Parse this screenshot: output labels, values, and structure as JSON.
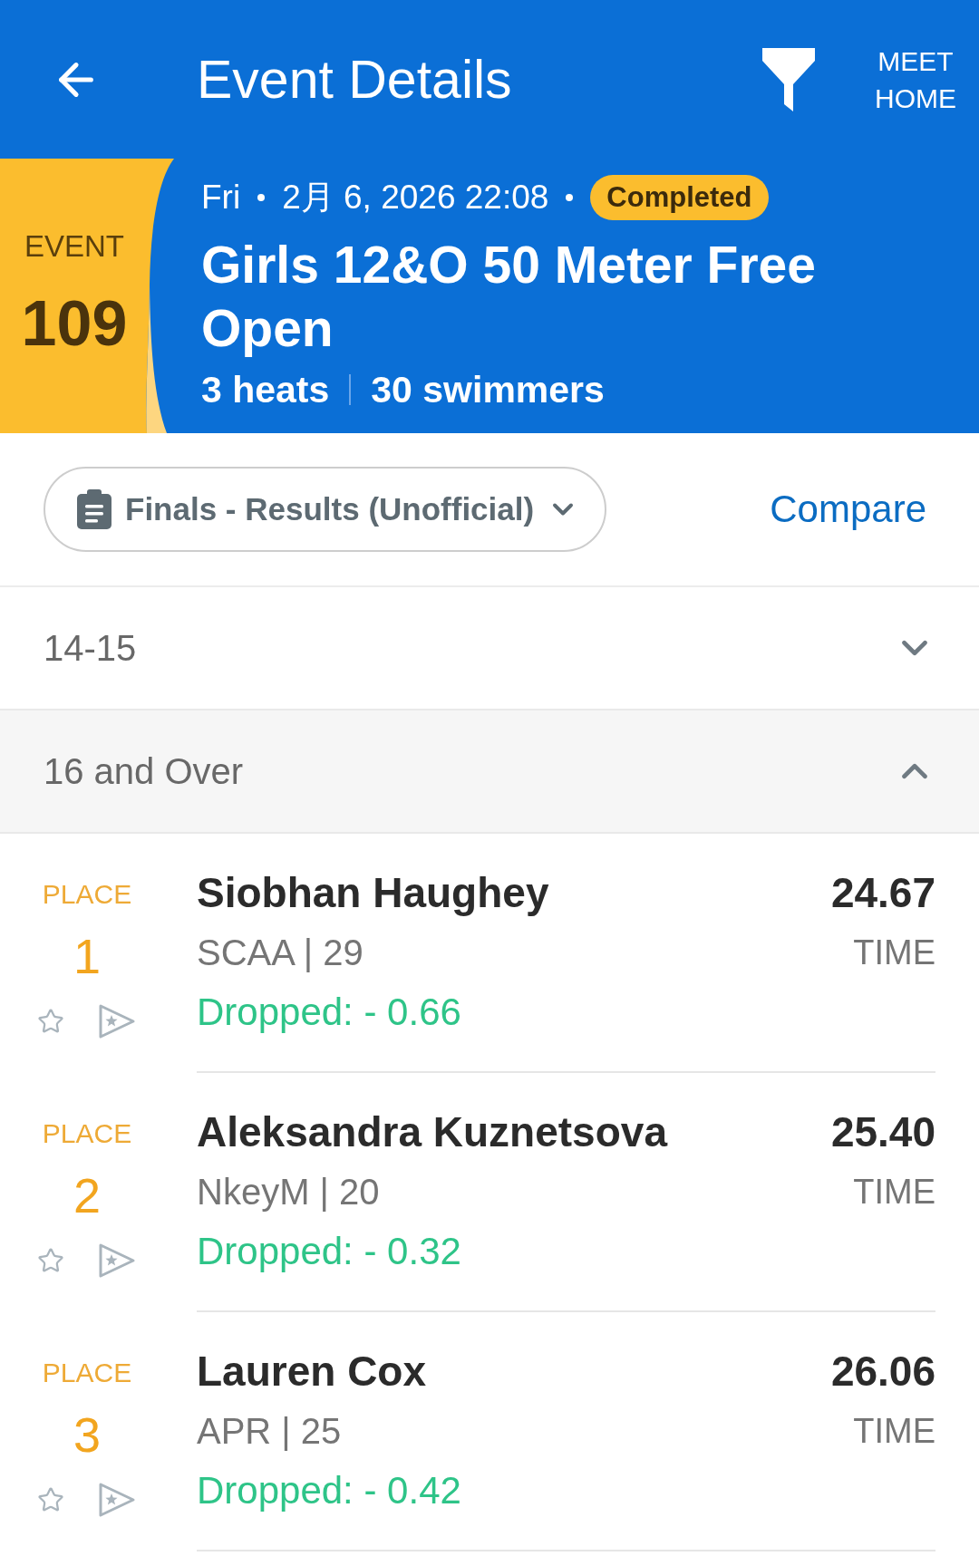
{
  "top_bar": {
    "title": "Event Details",
    "meet_home": "MEET HOME"
  },
  "event": {
    "label": "EVENT",
    "number": "109",
    "day": "Fri",
    "datetime": "2月 6, 2026 22:08",
    "status": "Completed",
    "title": "Girls 12&O 50 Meter Free Open",
    "heats": "3 heats",
    "swimmers": "30 swimmers"
  },
  "session": {
    "selection": "Finals - Results (Unofficial)",
    "compare": "Compare"
  },
  "age_groups": [
    {
      "label": "14-15",
      "expanded": false
    },
    {
      "label": "16 and Over",
      "expanded": true,
      "results": [
        {
          "place_label": "PLACE",
          "place": "1",
          "name": "Siobhan Haughey",
          "team": "SCAA | 29",
          "dropped": "Dropped: - 0.66",
          "time": "24.67",
          "time_label": "TIME"
        },
        {
          "place_label": "PLACE",
          "place": "2",
          "name": "Aleksandra Kuznetsova",
          "team": "NkeyM | 20",
          "dropped": "Dropped: - 0.32",
          "time": "25.40",
          "time_label": "TIME"
        },
        {
          "place_label": "PLACE",
          "place": "3",
          "name": "Lauren Cox",
          "team": "APR | 25",
          "dropped": "Dropped: - 0.42",
          "time": "26.06",
          "time_label": "TIME"
        }
      ]
    }
  ]
}
